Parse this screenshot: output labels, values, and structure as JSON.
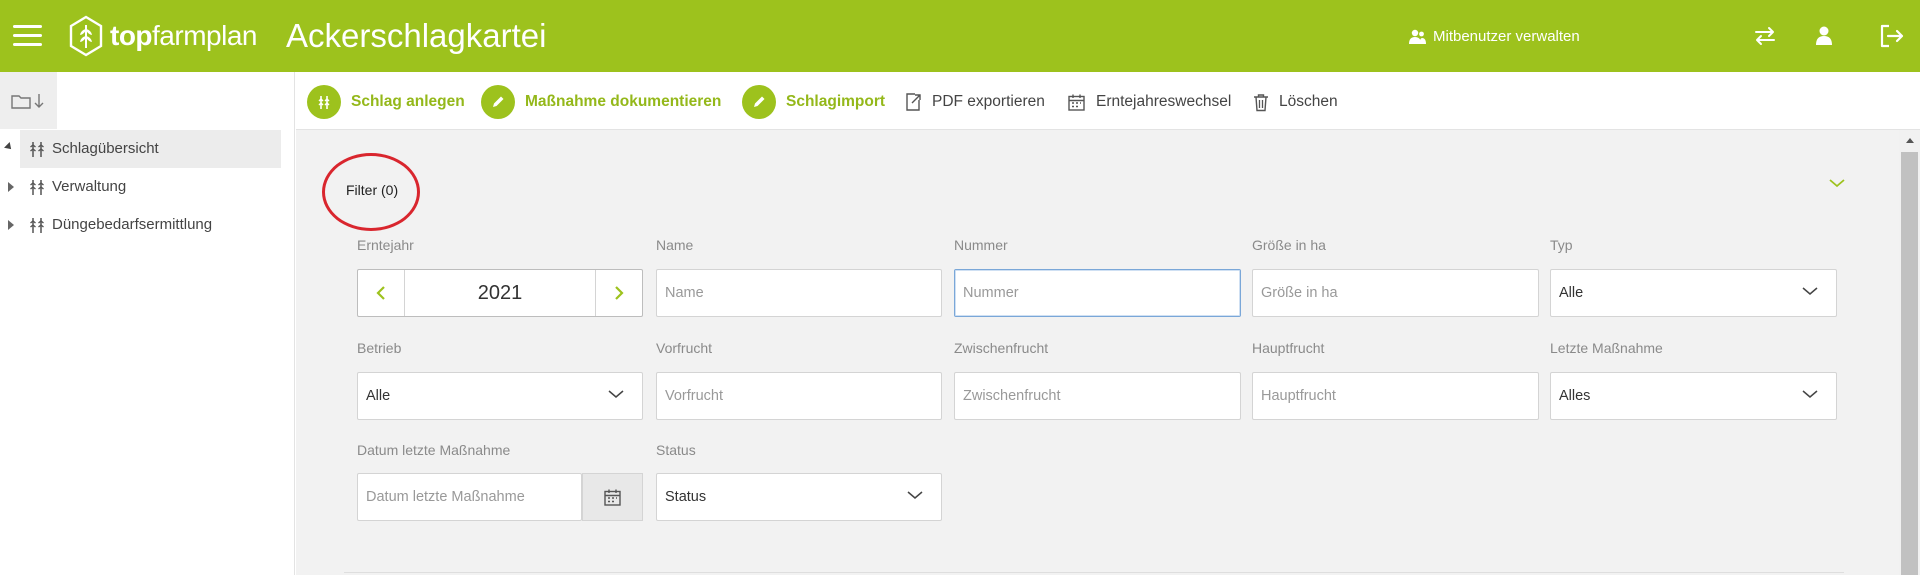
{
  "header": {
    "brand_bold": "top",
    "brand_rest": "farmplan",
    "app_title": "Ackerschlagkartei",
    "cousers_label": "Mitbenutzer verwalten"
  },
  "sidebar": {
    "items": [
      {
        "label": "Schlagübersicht",
        "expanded": true,
        "active": true
      },
      {
        "label": "Verwaltung",
        "expanded": false,
        "active": false
      },
      {
        "label": "Düngebedarfsermittlung",
        "expanded": false,
        "active": false
      }
    ]
  },
  "toolbar": {
    "new_field": "Schlag anlegen",
    "document_measure": "Maßnahme dokumentieren",
    "field_import": "Schlagimport",
    "export_pdf": "PDF exportieren",
    "year_change": "Erntejahreswechsel",
    "delete": "Löschen"
  },
  "filter": {
    "title": "Filter (0)",
    "year_label": "Erntejahr",
    "year_value": "2021",
    "name_label": "Name",
    "name_placeholder": "Name",
    "number_label": "Nummer",
    "number_placeholder": "Nummer",
    "size_label": "Größe in ha",
    "size_placeholder": "Größe in ha",
    "type_label": "Typ",
    "type_value": "Alle",
    "farm_label": "Betrieb",
    "farm_value": "Alle",
    "prev_crop_label": "Vorfrucht",
    "prev_crop_placeholder": "Vorfrucht",
    "catch_crop_label": "Zwischenfrucht",
    "catch_crop_placeholder": "Zwischenfrucht",
    "main_crop_label": "Hauptfrucht",
    "main_crop_placeholder": "Hauptfrucht",
    "last_measure_label": "Letzte Maßnahme",
    "last_measure_value": "Alles",
    "date_label": "Datum letzte Maßnahme",
    "date_placeholder": "Datum letzte Maßnahme",
    "status_label": "Status",
    "status_value": "Status"
  },
  "colors": {
    "brand_green": "#9dc21d",
    "highlight_red": "#d9262e"
  }
}
